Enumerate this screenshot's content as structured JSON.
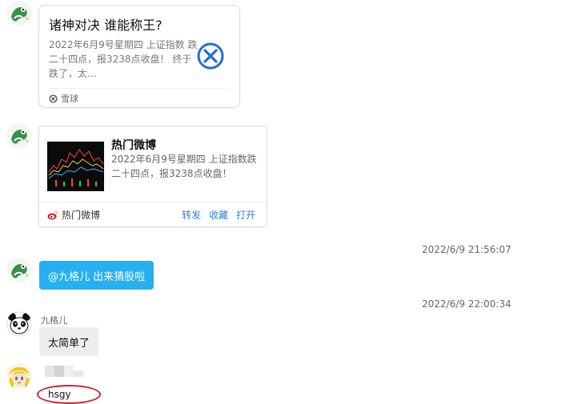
{
  "messages": {
    "card1": {
      "title": "诸神对决 谁能称王?",
      "desc": "2022年6月9号星期四 上证指数 跌二十四点，报3238点收盘！ 终于跌了，太...",
      "source": "雪球",
      "logo_icon": "xueqiu-logo-icon"
    },
    "card2": {
      "title": "热门微博",
      "desc": "2022年6月9号星期四 上证指数跌二十四点，报3238点收盘！",
      "source": "热门微博",
      "actions": {
        "forward": "转发",
        "favorite": "收藏",
        "open": "打开"
      }
    },
    "timestamp1": "2022/6/9 21:56:07",
    "bubble1": "@九格儿 出来猜股啦",
    "timestamp2": "2022/6/9 22:00:34",
    "sender2_name": "九格儿",
    "bubble2": "太简单了",
    "bubble3": "hsgy"
  },
  "colors": {
    "blue_bubble": "#26b0ef",
    "grey_bubble": "#ededed",
    "link": "#2f7fd8",
    "highlight_circle": "#d0202a"
  }
}
